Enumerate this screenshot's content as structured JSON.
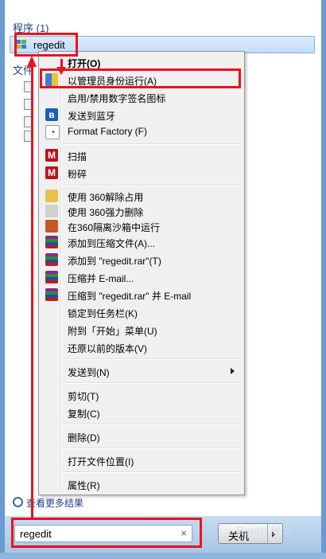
{
  "section_programs": "程序 (1)",
  "section_files": "文件",
  "result": {
    "label": "regedit",
    "icon": "regedit-icon"
  },
  "context_menu": {
    "items": [
      {
        "label": "打开(O)",
        "icon": "",
        "bold": true
      },
      {
        "label": "以管理员身份运行(A)",
        "icon": "uac-shield-icon"
      },
      {
        "label": "启用/禁用数字签名图标",
        "icon": ""
      },
      {
        "label": "发送到蓝牙",
        "icon": "bluetooth-icon"
      },
      {
        "label": "Format Factory (F)",
        "icon": "format-factory-icon"
      },
      {
        "label": "扫描",
        "icon": "mcafee-icon"
      },
      {
        "label": "粉碎",
        "icon": "mcafee-icon"
      },
      {
        "label": "使用 360解除占用",
        "icon": "360-unlock-icon"
      },
      {
        "label": "使用 360强力删除",
        "icon": "360-delete-icon"
      },
      {
        "label": "在360隔离沙箱中运行",
        "icon": "360-sandbox-icon"
      },
      {
        "label": "添加到压缩文件(A)...",
        "icon": "winrar-icon"
      },
      {
        "label": "添加到 \"regedit.rar\"(T)",
        "icon": "winrar-icon"
      },
      {
        "label": "压缩并 E-mail...",
        "icon": "winrar-icon"
      },
      {
        "label": "压缩到 \"regedit.rar\" 并 E-mail",
        "icon": "winrar-icon"
      },
      {
        "label": "锁定到任务栏(K)",
        "icon": ""
      },
      {
        "label": "附到「开始」菜单(U)",
        "icon": ""
      },
      {
        "label": "还原以前的版本(V)",
        "icon": ""
      },
      {
        "label": "发送到(N)",
        "icon": "",
        "submenu": true
      },
      {
        "label": "剪切(T)",
        "icon": ""
      },
      {
        "label": "复制(C)",
        "icon": ""
      },
      {
        "label": "删除(D)",
        "icon": ""
      },
      {
        "label": "打开文件位置(I)",
        "icon": ""
      },
      {
        "label": "属性(R)",
        "icon": ""
      }
    ]
  },
  "see_more": "查看更多结果",
  "search": {
    "value": "regedit",
    "clear_glyph": "×"
  },
  "shutdown_label": "关机",
  "watermark": "Baidu 经验",
  "colors": {
    "annotation": "#e8141c",
    "section_blue": "#1e3f8b",
    "frame": "#6a9bd0"
  }
}
